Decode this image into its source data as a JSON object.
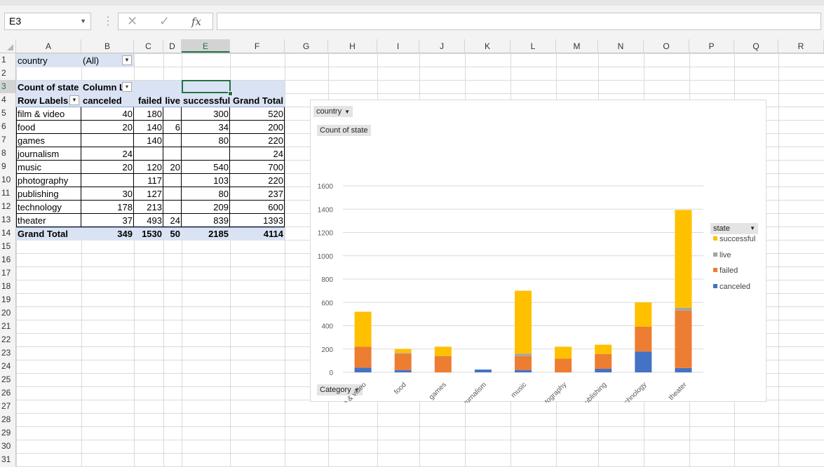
{
  "name_box": "E3",
  "formula_value": "",
  "icons": {
    "cancel": "✕",
    "enter": "✓",
    "fx": "fx"
  },
  "columns": [
    "A",
    "B",
    "C",
    "D",
    "E",
    "F",
    "G",
    "H",
    "I",
    "J",
    "K",
    "L",
    "M",
    "N",
    "O",
    "P",
    "Q",
    "R"
  ],
  "rows": [
    "1",
    "2",
    "3",
    "4",
    "5",
    "6",
    "7",
    "8",
    "9",
    "10",
    "11",
    "12",
    "13",
    "14",
    "15",
    "16",
    "17",
    "18",
    "19",
    "20",
    "21",
    "22",
    "23",
    "24",
    "25",
    "26",
    "27",
    "28",
    "29",
    "30",
    "31"
  ],
  "pivot": {
    "filter_label": "country",
    "filter_value": "(All)",
    "values_label": "Count of state",
    "column_labels": "Column L",
    "row_labels": "Row Labels",
    "headers": [
      "canceled",
      "failed",
      "live",
      "successful",
      "Grand Total"
    ],
    "body": [
      {
        "label": "film & video",
        "canceled": "40",
        "failed": "180",
        "live": "",
        "successful": "300",
        "total": "520"
      },
      {
        "label": "food",
        "canceled": "20",
        "failed": "140",
        "live": "6",
        "successful": "34",
        "total": "200"
      },
      {
        "label": "games",
        "canceled": "",
        "failed": "140",
        "live": "",
        "successful": "80",
        "total": "220"
      },
      {
        "label": "journalism",
        "canceled": "24",
        "failed": "",
        "live": "",
        "successful": "",
        "total": "24"
      },
      {
        "label": "music",
        "canceled": "20",
        "failed": "120",
        "live": "20",
        "successful": "540",
        "total": "700"
      },
      {
        "label": "photography",
        "canceled": "",
        "failed": "117",
        "live": "",
        "successful": "103",
        "total": "220"
      },
      {
        "label": "publishing",
        "canceled": "30",
        "failed": "127",
        "live": "",
        "successful": "80",
        "total": "237"
      },
      {
        "label": "technology",
        "canceled": "178",
        "failed": "213",
        "live": "",
        "successful": "209",
        "total": "600"
      },
      {
        "label": "theater",
        "canceled": "37",
        "failed": "493",
        "live": "24",
        "successful": "839",
        "total": "1393"
      }
    ],
    "grand_total": {
      "label": "Grand Total",
      "canceled": "349",
      "failed": "1530",
      "live": "50",
      "successful": "2185",
      "total": "4114"
    }
  },
  "chart_data": {
    "type": "bar",
    "stacked": true,
    "categories": [
      "film & video",
      "food",
      "games",
      "journalism",
      "music",
      "photography",
      "publishing",
      "technology",
      "theater"
    ],
    "series": [
      {
        "name": "canceled",
        "color": "#4472c4",
        "values": [
          40,
          20,
          0,
          24,
          20,
          0,
          30,
          178,
          37
        ]
      },
      {
        "name": "failed",
        "color": "#ed7d31",
        "values": [
          180,
          140,
          140,
          0,
          120,
          117,
          127,
          213,
          493
        ]
      },
      {
        "name": "live",
        "color": "#a5a5a5",
        "values": [
          0,
          6,
          0,
          0,
          20,
          0,
          0,
          0,
          24
        ]
      },
      {
        "name": "successful",
        "color": "#ffc000",
        "values": [
          300,
          34,
          80,
          0,
          540,
          103,
          80,
          209,
          839
        ]
      }
    ],
    "ylim": [
      0,
      1600
    ],
    "yticks": [
      "0",
      "200",
      "400",
      "600",
      "800",
      "1000",
      "1200",
      "1400",
      "1600"
    ],
    "grid": true,
    "legend_placement": "right",
    "legend_title": "state",
    "legend_order": [
      "successful",
      "live",
      "failed",
      "canceled"
    ],
    "filter_button": "country",
    "value_button": "Count of state",
    "axis_button": "Category"
  }
}
